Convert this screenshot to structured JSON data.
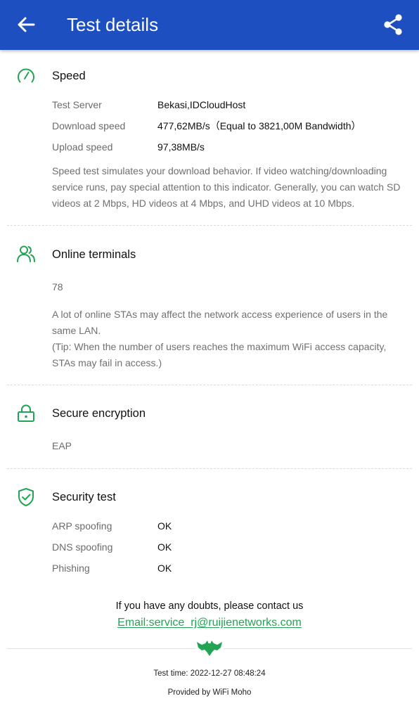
{
  "appbar": {
    "title": "Test details",
    "back_icon": "arrow-left-icon",
    "share_icon": "share-icon",
    "background": "#1d4fc0"
  },
  "accent_color": "#22a454",
  "speed": {
    "title": "Speed",
    "icon": "speedometer-icon",
    "rows": [
      {
        "label": "Test Server",
        "value": "Bekasi,IDCloudHost"
      },
      {
        "label": "Download speed",
        "value": "477,62MB/s（Equal to 3821,00M Bandwidth）"
      },
      {
        "label": "Upload speed",
        "value": "97,38MB/s"
      }
    ],
    "description": "Speed test simulates your download behavior. If video watching/downloading service runs, pay special attention to this indicator. Generally, you can watch SD videos at 2 Mbps, HD videos at 4 Mbps, and UHD videos at 10 Mbps."
  },
  "terminals": {
    "title": "Online terminals",
    "icon": "users-icon",
    "count": "78",
    "description_1": "A lot of online STAs may affect the network access experience of users in the same LAN.",
    "description_2": "(Tip: When the number of users reaches the maximum WiFi access capacity, STAs may fail in access.)"
  },
  "encryption": {
    "title": "Secure encryption",
    "icon": "lock-icon",
    "value": "EAP"
  },
  "security": {
    "title": "Security test",
    "icon": "shield-check-icon",
    "rows": [
      {
        "label": "ARP spoofing",
        "value": "OK"
      },
      {
        "label": "DNS spoofing",
        "value": "OK"
      },
      {
        "label": "Phishing",
        "value": "OK"
      }
    ]
  },
  "footer": {
    "contact_text": "If you have any doubts, please contact us",
    "email": "Email:service_rj@ruijienetworks.com",
    "brand_icon": "bat-logo-icon",
    "test_time": "Test time: 2022-12-27 08:48:24",
    "provided_by": "Provided by WiFi Moho"
  }
}
